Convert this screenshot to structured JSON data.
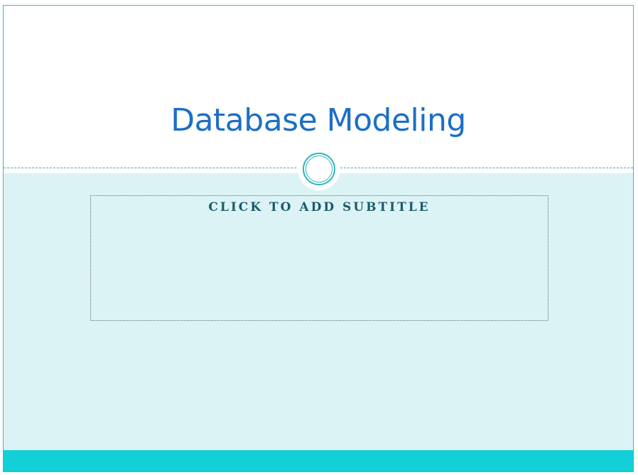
{
  "slide": {
    "title": "Database Modeling",
    "subtitle_placeholder": "CLICK TO ADD SUBTITLE"
  },
  "ornament": {
    "icon": "double-circle-icon"
  },
  "colors": {
    "title": "#1c6fc6",
    "subtitle": "#1a5b6b",
    "panel": "#dcf3f6",
    "footer": "#12cfd8",
    "accent": "#2fb6be"
  }
}
